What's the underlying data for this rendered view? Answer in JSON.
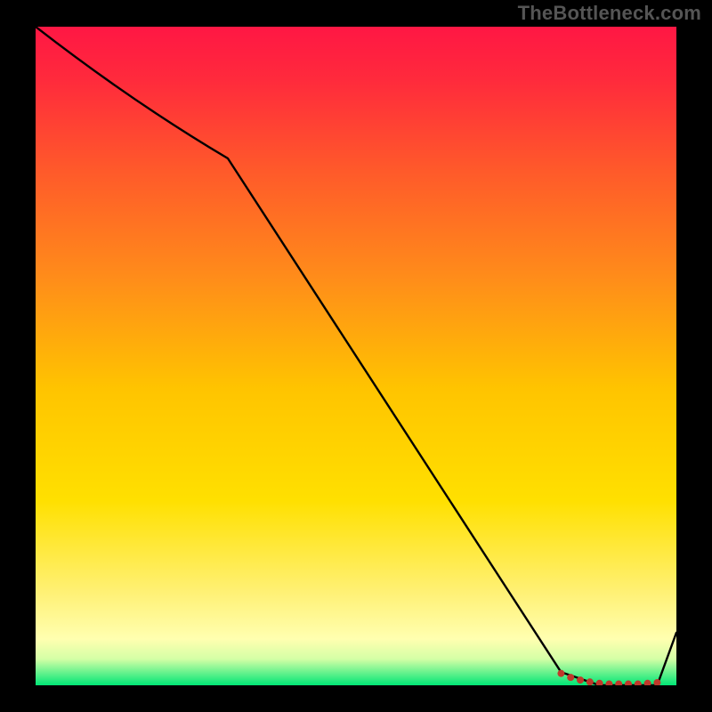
{
  "watermark": "TheBottleneck.com",
  "chart_data": {
    "type": "line",
    "title": "",
    "xlabel": "",
    "ylabel": "",
    "xlim": [
      0,
      100
    ],
    "ylim": [
      0,
      100
    ],
    "x": [
      0,
      30,
      82,
      88,
      97,
      100
    ],
    "values": [
      100,
      80,
      2,
      0,
      0,
      8
    ],
    "gradient_stops": [
      {
        "offset": 0.0,
        "color": "#ff1744"
      },
      {
        "offset": 0.08,
        "color": "#ff2a3c"
      },
      {
        "offset": 0.22,
        "color": "#ff5a2a"
      },
      {
        "offset": 0.38,
        "color": "#ff8c1a"
      },
      {
        "offset": 0.55,
        "color": "#ffc400"
      },
      {
        "offset": 0.72,
        "color": "#ffe000"
      },
      {
        "offset": 0.86,
        "color": "#fff176"
      },
      {
        "offset": 0.93,
        "color": "#ffffb0"
      },
      {
        "offset": 0.96,
        "color": "#d4ffa6"
      },
      {
        "offset": 1.0,
        "color": "#00e676"
      }
    ],
    "markers": {
      "x": [
        82,
        83.5,
        85,
        86.5,
        88,
        89.5,
        91,
        92.5,
        94,
        95.5,
        97
      ],
      "y": [
        1.8,
        1.2,
        0.8,
        0.5,
        0.3,
        0.2,
        0.2,
        0.2,
        0.2,
        0.3,
        0.4
      ],
      "color": "#c0392b",
      "radius": 4
    }
  }
}
